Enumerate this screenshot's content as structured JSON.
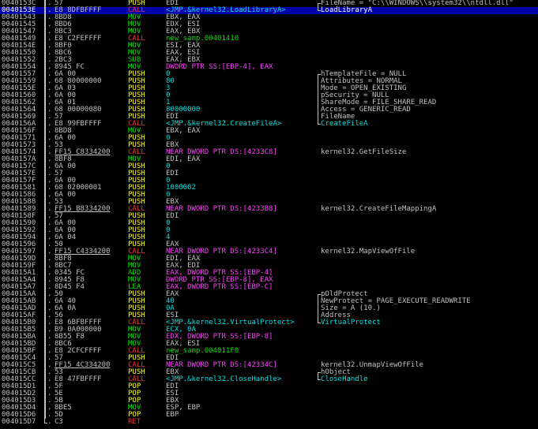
{
  "colors": {
    "background": "#000000",
    "selection": "#0000a8",
    "text": "#c0c0c0",
    "push_pop": "#ffff00",
    "mov_arith": "#00e000",
    "call_ret": "#ff3030",
    "memory_operand": "#ff40ff",
    "call_target": "#00e0e0"
  },
  "rows": [
    {
      "addr": "0040153C",
      "bracket": "bar",
      "hex": "57",
      "mn": "PUSH",
      "mnc": "y",
      "op": "EDI",
      "opc": "w",
      "cmt": "FileName = \"C:\\\\WINDOWS\\\\system32\\\\ntdll.dll\"",
      "cbr": "top"
    },
    {
      "addr": "0040153E",
      "bracket": "bar",
      "hex": "E8 8DFBFFFF",
      "mn": "CALL",
      "mnc": "r",
      "op": "<JMP.&kernel32.LoadLibraryA>",
      "opc": "c",
      "cmt": "LoadLibraryA",
      "cmtc": "c",
      "cbr": "bot",
      "sel": true
    },
    {
      "addr": "00401543",
      "bracket": "bar",
      "hex": "8BD8",
      "mn": "MOV",
      "mnc": "g",
      "op": "EBX, EAX",
      "opc": "w"
    },
    {
      "addr": "00401545",
      "bracket": "bar",
      "hex": "8BD6",
      "mn": "MOV",
      "mnc": "g",
      "op": "EDX, ESI",
      "opc": "w"
    },
    {
      "addr": "00401547",
      "bracket": "bar",
      "hex": "8BC3",
      "mn": "MOV",
      "mnc": "g",
      "op": "EAX, EBX",
      "opc": "w"
    },
    {
      "addr": "00401549",
      "bracket": "bar",
      "hex": "E8 C2FEFFFF",
      "mn": "CALL",
      "mnc": "r",
      "op": "new_samp.00401410",
      "opc": "g"
    },
    {
      "addr": "0040154E",
      "bracket": "bar",
      "hex": "8BF0",
      "mn": "MOV",
      "mnc": "g",
      "op": "ESI, EAX",
      "opc": "w"
    },
    {
      "addr": "00401550",
      "bracket": "bar",
      "hex": "8BC6",
      "mn": "MOV",
      "mnc": "g",
      "op": "EAX, ESI",
      "opc": "w"
    },
    {
      "addr": "00401552",
      "bracket": "bar",
      "hex": "2BC3",
      "mn": "SUB",
      "mnc": "g",
      "op": "EAX, EBX",
      "opc": "w"
    },
    {
      "addr": "00401554",
      "bracket": "bar",
      "hex": "8945 FC",
      "mn": "MOV",
      "mnc": "g",
      "op": "DWORD PTR SS:[EBP-4], EAX",
      "opc": "m"
    },
    {
      "addr": "00401557",
      "bracket": "bar",
      "hex": "6A 00",
      "mn": "PUSH",
      "mnc": "y",
      "op": "0",
      "opc": "c",
      "cmt": "hTemplateFile = NULL",
      "cbr": "top"
    },
    {
      "addr": "00401559",
      "bracket": "bar",
      "hex": "68 80000000",
      "mn": "PUSH",
      "mnc": "y",
      "op": "80",
      "opc": "c",
      "cmt": "Attributes = NORMAL",
      "cbr": "mid"
    },
    {
      "addr": "0040155E",
      "bracket": "bar",
      "hex": "6A 03",
      "mn": "PUSH",
      "mnc": "y",
      "op": "3",
      "opc": "c",
      "cmt": "Mode = OPEN_EXISTING",
      "cbr": "mid"
    },
    {
      "addr": "00401560",
      "bracket": "bar",
      "hex": "6A 00",
      "mn": "PUSH",
      "mnc": "y",
      "op": "0",
      "opc": "c",
      "cmt": "pSecurity = NULL",
      "cbr": "mid"
    },
    {
      "addr": "00401562",
      "bracket": "bar",
      "hex": "6A 01",
      "mn": "PUSH",
      "mnc": "y",
      "op": "1",
      "opc": "c",
      "cmt": "ShareMode = FILE_SHARE_READ",
      "cbr": "mid"
    },
    {
      "addr": "00401564",
      "bracket": "bar",
      "hex": "68 00000080",
      "mn": "PUSH",
      "mnc": "y",
      "op": "80000000",
      "opc": "c",
      "cmt": "Access = GENERIC_READ",
      "cbr": "mid"
    },
    {
      "addr": "00401569",
      "bracket": "bar",
      "hex": "57",
      "mn": "PUSH",
      "mnc": "y",
      "op": "EDI",
      "opc": "w",
      "cmt": "FileName",
      "cbr": "mid"
    },
    {
      "addr": "0040156A",
      "bracket": "bar",
      "hex": "E8 99FBFFFF",
      "mn": "CALL",
      "mnc": "r",
      "op": "<JMP.&kernel32.CreateFileA>",
      "opc": "c",
      "cmt": "CreateFileA",
      "cmtc": "c",
      "cbr": "bot"
    },
    {
      "addr": "0040156F",
      "bracket": "bar",
      "hex": "8BD8",
      "mn": "MOV",
      "mnc": "g",
      "op": "EBX, EAX",
      "opc": "w"
    },
    {
      "addr": "00401571",
      "bracket": "bar",
      "hex": "6A 00",
      "mn": "PUSH",
      "mnc": "y",
      "op": "0",
      "opc": "c"
    },
    {
      "addr": "00401573",
      "bracket": "bar",
      "hex": "53",
      "mn": "PUSH",
      "mnc": "y",
      "op": "EBX",
      "opc": "w"
    },
    {
      "addr": "00401574",
      "bracket": "bar",
      "hex": "FF15 C8334200",
      "hexul": true,
      "mn": "CALL",
      "mnc": "r",
      "op": "NEAR DWORD PTR DS:[4233C8]",
      "opc": "m",
      "cmt": "kernel32.GetFileSize"
    },
    {
      "addr": "0040157A",
      "bracket": "bar",
      "hex": "8BF8",
      "mn": "MOV",
      "mnc": "g",
      "op": "EDI, EAX",
      "opc": "w"
    },
    {
      "addr": "0040157C",
      "bracket": "bar",
      "hex": "6A 00",
      "mn": "PUSH",
      "mnc": "y",
      "op": "0",
      "opc": "c"
    },
    {
      "addr": "0040157E",
      "bracket": "bar",
      "hex": "57",
      "mn": "PUSH",
      "mnc": "y",
      "op": "EDI",
      "opc": "w"
    },
    {
      "addr": "0040157F",
      "bracket": "bar",
      "hex": "6A 00",
      "mn": "PUSH",
      "mnc": "y",
      "op": "0",
      "opc": "c"
    },
    {
      "addr": "00401581",
      "bracket": "bar",
      "hex": "68 02000001",
      "mn": "PUSH",
      "mnc": "y",
      "op": "1000002",
      "opc": "c"
    },
    {
      "addr": "00401586",
      "bracket": "bar",
      "hex": "6A 00",
      "mn": "PUSH",
      "mnc": "y",
      "op": "0",
      "opc": "c"
    },
    {
      "addr": "00401588",
      "bracket": "bar",
      "hex": "53",
      "mn": "PUSH",
      "mnc": "y",
      "op": "EBX",
      "opc": "w"
    },
    {
      "addr": "00401589",
      "bracket": "bar",
      "hex": "FF15 B8334200",
      "hexul": true,
      "mn": "CALL",
      "mnc": "r",
      "op": "NEAR DWORD PTR DS:[4233B8]",
      "opc": "m",
      "cmt": "kernel32.CreateFileMappingA"
    },
    {
      "addr": "0040158F",
      "bracket": "bar",
      "hex": "57",
      "mn": "PUSH",
      "mnc": "y",
      "op": "EDI",
      "opc": "w"
    },
    {
      "addr": "00401590",
      "bracket": "bar",
      "hex": "6A 00",
      "mn": "PUSH",
      "mnc": "y",
      "op": "0",
      "opc": "c"
    },
    {
      "addr": "00401592",
      "bracket": "bar",
      "hex": "6A 00",
      "mn": "PUSH",
      "mnc": "y",
      "op": "0",
      "opc": "c"
    },
    {
      "addr": "00401594",
      "bracket": "bar",
      "hex": "6A 04",
      "mn": "PUSH",
      "mnc": "y",
      "op": "4",
      "opc": "c"
    },
    {
      "addr": "00401596",
      "bracket": "bar",
      "hex": "50",
      "mn": "PUSH",
      "mnc": "y",
      "op": "EAX",
      "opc": "w"
    },
    {
      "addr": "00401597",
      "bracket": "bar",
      "hex": "FF15 C4334200",
      "hexul": true,
      "mn": "CALL",
      "mnc": "r",
      "op": "NEAR DWORD PTR DS:[4233C4]",
      "opc": "m",
      "cmt": "kernel32.MapViewOfFile"
    },
    {
      "addr": "0040159D",
      "bracket": "bar",
      "hex": "8BF8",
      "mn": "MOV",
      "mnc": "g",
      "op": "EDI, EAX",
      "opc": "w"
    },
    {
      "addr": "0040159F",
      "bracket": "bar",
      "hex": "8BC7",
      "mn": "MOV",
      "mnc": "g",
      "op": "EAX, EDI",
      "opc": "w"
    },
    {
      "addr": "004015A1",
      "bracket": "bar",
      "hex": "0345 FC",
      "mn": "ADD",
      "mnc": "g",
      "op": "EAX, DWORD PTR SS:[EBP-4]",
      "opc": "m"
    },
    {
      "addr": "004015A4",
      "bracket": "bar",
      "hex": "8945 F8",
      "mn": "MOV",
      "mnc": "g",
      "op": "DWORD PTR SS:[EBP-8], EAX",
      "opc": "m"
    },
    {
      "addr": "004015A7",
      "bracket": "bar",
      "hex": "8D45 F4",
      "mn": "LEA",
      "mnc": "g",
      "op": "EAX, DWORD PTR SS:[EBP-C]",
      "opc": "m"
    },
    {
      "addr": "004015AA",
      "bracket": "bar",
      "hex": "50",
      "mn": "PUSH",
      "mnc": "y",
      "op": "EAX",
      "opc": "w",
      "cmt": "pOldProtect",
      "cbr": "top"
    },
    {
      "addr": "004015AB",
      "bracket": "bar",
      "hex": "6A 40",
      "mn": "PUSH",
      "mnc": "y",
      "op": "40",
      "opc": "c",
      "cmt": "NewProtect = PAGE_EXECUTE_READWRITE",
      "cbr": "mid"
    },
    {
      "addr": "004015AD",
      "bracket": "bar",
      "hex": "6A 0A",
      "mn": "PUSH",
      "mnc": "y",
      "op": "0A",
      "opc": "c",
      "cmt": "Size = A (10.)",
      "cbr": "mid"
    },
    {
      "addr": "004015AF",
      "bracket": "bar",
      "hex": "56",
      "mn": "PUSH",
      "mnc": "y",
      "op": "ESI",
      "opc": "w",
      "cmt": "Address",
      "cbr": "mid"
    },
    {
      "addr": "004015B0",
      "bracket": "bar",
      "hex": "E8 6BFBFFFF",
      "mn": "CALL",
      "mnc": "r",
      "op": "<JMP.&kernel32.VirtualProtect>",
      "opc": "c",
      "cmt": "VirtualProtect",
      "cmtc": "c",
      "cbr": "bot"
    },
    {
      "addr": "004015B5",
      "bracket": "bar",
      "hex": "B9 0A000000",
      "mn": "MOV",
      "mnc": "g",
      "op": "ECX, 0A",
      "opc": "c"
    },
    {
      "addr": "004015BA",
      "bracket": "bar",
      "hex": "8B55 F8",
      "mn": "MOV",
      "mnc": "g",
      "op": "EDX, DWORD PTR SS:[EBP-8]",
      "opc": "m"
    },
    {
      "addr": "004015BD",
      "bracket": "bar",
      "hex": "8BC6",
      "mn": "MOV",
      "mnc": "g",
      "op": "EAX, ESI",
      "opc": "w"
    },
    {
      "addr": "004015BF",
      "bracket": "bar",
      "hex": "E8 2CFCFFFF",
      "mn": "CALL",
      "mnc": "r",
      "op": "new_samp.004011F0",
      "opc": "g"
    },
    {
      "addr": "004015C4",
      "bracket": "bar",
      "hex": "57",
      "mn": "PUSH",
      "mnc": "y",
      "op": "EDI",
      "opc": "w"
    },
    {
      "addr": "004015C5",
      "bracket": "bar",
      "hex": "FF15 4C334200",
      "hexul": true,
      "mn": "CALL",
      "mnc": "r",
      "op": "NEAR DWORD PTR DS:[42334C]",
      "opc": "m",
      "cmt": "kernel32.UnmapViewOfFile"
    },
    {
      "addr": "004015CB",
      "bracket": "bar",
      "hex": "53",
      "mn": "PUSH",
      "mnc": "y",
      "op": "EBX",
      "opc": "w",
      "cmt": "hObject",
      "cbr": "top"
    },
    {
      "addr": "004015CC",
      "bracket": "bar",
      "hex": "E8 47FBFFFF",
      "mn": "CALL",
      "mnc": "r",
      "op": "<JMP.&kernel32.CloseHandle>",
      "opc": "c",
      "cmt": "CloseHandle",
      "cmtc": "c",
      "cbr": "bot"
    },
    {
      "addr": "004015D1",
      "bracket": "bar",
      "hex": "5F",
      "mn": "POP",
      "mnc": "y",
      "op": "EDI",
      "opc": "w"
    },
    {
      "addr": "004015D2",
      "bracket": "bar",
      "hex": "5E",
      "mn": "POP",
      "mnc": "y",
      "op": "ESI",
      "opc": "w"
    },
    {
      "addr": "004015D3",
      "bracket": "bar",
      "hex": "5B",
      "mn": "POP",
      "mnc": "y",
      "op": "EBX",
      "opc": "w"
    },
    {
      "addr": "004015D4",
      "bracket": "bar",
      "hex": "8BE5",
      "mn": "MOV",
      "mnc": "g",
      "op": "ESP, EBP",
      "opc": "w"
    },
    {
      "addr": "004015D6",
      "bracket": "bar",
      "hex": "5D",
      "mn": "POP",
      "mnc": "y",
      "op": "EBP",
      "opc": "w"
    },
    {
      "addr": "004015D7",
      "bracket": "bot",
      "hex": "C3",
      "mn": "RET",
      "mnc": "r",
      "op": "",
      "opc": "w"
    }
  ]
}
